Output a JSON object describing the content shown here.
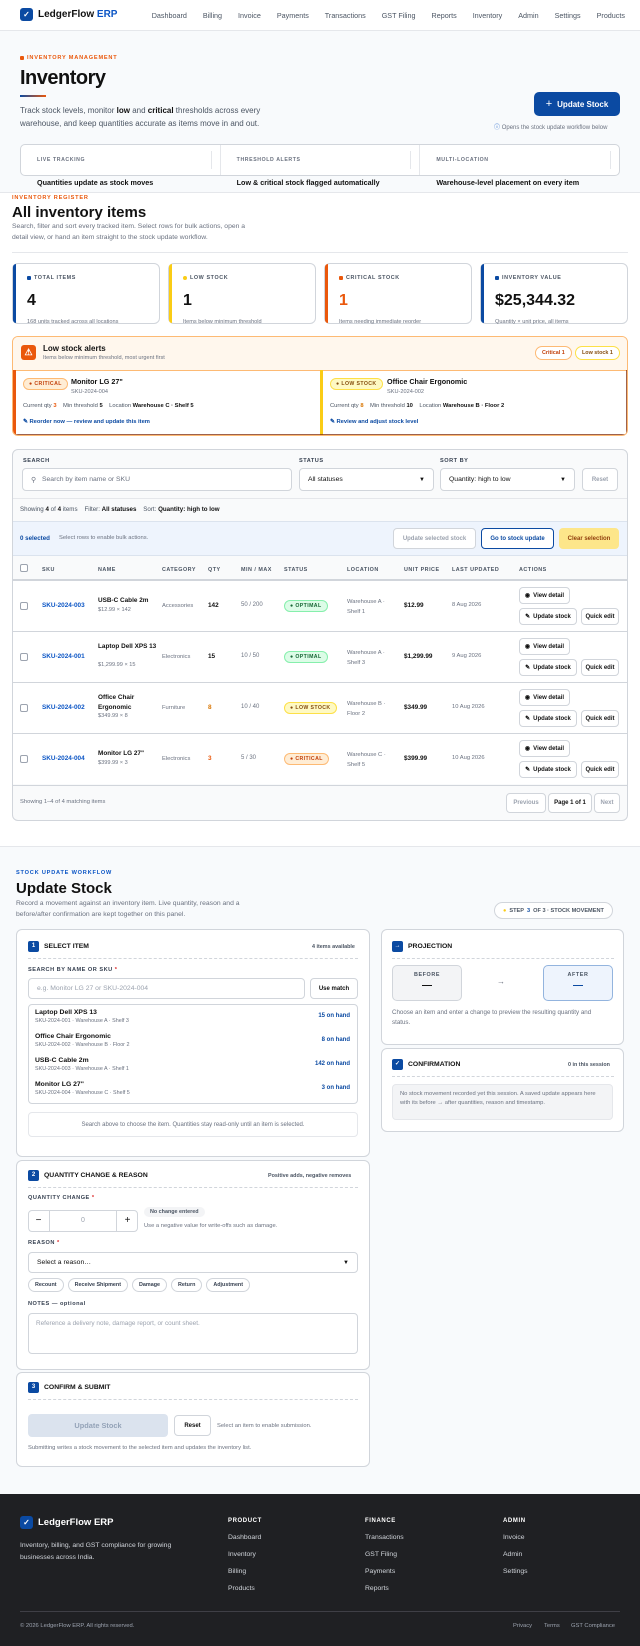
{
  "nav": {
    "brand_main": "LedgerFlow",
    "brand_accent": "ERP",
    "links": [
      "Dashboard",
      "Billing",
      "Invoice",
      "Payments",
      "Transactions",
      "GST Filing",
      "Reports",
      "Inventory",
      "Admin",
      "Settings",
      "Products"
    ]
  },
  "hero": {
    "eyebrow": "INVENTORY MANAGEMENT",
    "title": "Inventory",
    "desc_1": "Track stock levels, monitor ",
    "desc_low": "low",
    "desc_2": " and ",
    "desc_critical": "critical",
    "desc_3": " thresholds across every warehouse, and keep quantities accurate as items move in and out.",
    "cta": "Update Stock",
    "cta_hint": "Opens the stock update workflow below",
    "features": [
      {
        "k": "LIVE TRACKING",
        "v": "Quantities update as stock moves"
      },
      {
        "k": "THRESHOLD ALERTS",
        "v": "Low & critical stock flagged automatically"
      },
      {
        "k": "MULTI-LOCATION",
        "v": "Warehouse-level placement on every item"
      }
    ]
  },
  "register": {
    "eyebrow": "INVENTORY REGISTER",
    "title": "All inventory items",
    "desc": "Search, filter and sort every tracked item. Select rows for bulk actions, open a detail view, or hand an item straight to the stock update workflow."
  },
  "kpis": [
    {
      "label": "TOTAL ITEMS",
      "value": "4",
      "sub": "168 units tracked across all locations",
      "color": "#0b4aa2"
    },
    {
      "label": "LOW STOCK",
      "value": "1",
      "sub": "Items below minimum threshold",
      "color": "#facc15"
    },
    {
      "label": "CRITICAL STOCK",
      "value": "1",
      "sub": "Items needing immediate reorder",
      "color": "#ea580c"
    },
    {
      "label": "INVENTORY VALUE",
      "value": "$25,344.32",
      "sub": "Quantity × unit price, all items",
      "color": "#0b4aa2"
    }
  ],
  "alerts": {
    "title": "Low stock alerts",
    "sub": "Items below minimum threshold, most urgent first",
    "badge_critical": "Critical 1",
    "badge_low": "Low stock 1",
    "items": [
      {
        "status": "CRITICAL",
        "name": "Monitor LG 27\"",
        "sku": "SKU-2024-004",
        "qty_label": "Current qty",
        "qty": "3",
        "min_label": "Min threshold",
        "min": "5",
        "loc_label": "Location",
        "loc": "Warehouse C · Shelf 5",
        "action": "Reorder now — review and update this item"
      },
      {
        "status": "LOW STOCK",
        "name": "Office Chair Ergonomic",
        "sku": "SKU-2024-002",
        "qty_label": "Current qty",
        "qty": "8",
        "min_label": "Min threshold",
        "min": "10",
        "loc_label": "Location",
        "loc": "Warehouse B · Floor 2",
        "action": "Review and adjust stock level"
      }
    ]
  },
  "filters": {
    "search_label": "SEARCH",
    "search_placeholder": "Search by item name or SKU",
    "status_label": "STATUS",
    "status_value": "All statuses",
    "sort_label": "SORT BY",
    "sort_value": "Quantity: high to low",
    "reset": "Reset",
    "showing_prefix": "Showing",
    "shown": "4",
    "of": "of",
    "total": "4",
    "items_word": "items",
    "filter_label": "Filter:",
    "filter_value": "All statuses",
    "sort_label2": "Sort:",
    "sort_value2": "Quantity: high to low"
  },
  "bulk": {
    "selected": "0 selected",
    "hint": "Select rows to enable bulk actions.",
    "update_selected": "Update selected stock",
    "go_update": "Go to stock update",
    "clear": "Clear selection"
  },
  "table": {
    "headers": [
      "SKU",
      "NAME",
      "CATEGORY",
      "QTY",
      "MIN / MAX",
      "STATUS",
      "LOCATION",
      "UNIT PRICE",
      "LAST UPDATED",
      "ACTIONS"
    ],
    "rows": [
      {
        "sku": "SKU-2024-003",
        "name": "USB-C Cable 2m",
        "sub": "$12.99 × 142",
        "cat": "Accessories",
        "qty": "142",
        "minmax": "50 / 200",
        "status": "OPTIMAL",
        "loc": "Warehouse A · Shelf 1",
        "price": "$12.99",
        "updated": "8 Aug 2026",
        "qtycolor": "#111"
      },
      {
        "sku": "SKU-2024-001",
        "name": "Laptop Dell XPS 13",
        "sub": "$1,299.99 × 15",
        "cat": "Electronics",
        "qty": "15",
        "minmax": "10 / 50",
        "status": "OPTIMAL",
        "loc": "Warehouse A · Shelf 3",
        "price": "$1,299.99",
        "updated": "9 Aug 2026",
        "qtycolor": "#111"
      },
      {
        "sku": "SKU-2024-002",
        "name": "Office Chair Ergonomic",
        "sub": "$349.99 × 8",
        "cat": "Furniture",
        "qty": "8",
        "minmax": "10 / 40",
        "status": "LOW STOCK",
        "loc": "Warehouse B · Floor 2",
        "price": "$349.99",
        "updated": "10 Aug 2026",
        "qtycolor": "#d97706"
      },
      {
        "sku": "SKU-2024-004",
        "name": "Monitor LG 27\"",
        "sub": "$399.99 × 3",
        "cat": "Electronics",
        "qty": "3",
        "minmax": "5 / 30",
        "status": "CRITICAL",
        "loc": "Warehouse C · Shelf 5",
        "price": "$399.99",
        "updated": "10 Aug 2026",
        "qtycolor": "#ea580c"
      }
    ],
    "view": "View detail",
    "update": "Update stock",
    "quick": "Quick edit",
    "footer": "Showing 1–4 of 4 matching items",
    "prev": "Previous",
    "page": "Page 1 of 1",
    "next": "Next"
  },
  "workflow": {
    "eyebrow": "STOCK UPDATE WORKFLOW",
    "title": "Update Stock",
    "desc": "Record a movement against an inventory item. Live quantity, reason and a before/after confirmation are kept together on this panel.",
    "step_a": "STEP",
    "step_n": "3",
    "step_b": "OF 3 · STOCK MOVEMENT",
    "s1": {
      "num": "1",
      "title": "SELECT ITEM",
      "meta": "4 items available",
      "label": "SEARCH BY NAME OR SKU",
      "req": "*",
      "placeholder": "e.g. Monitor LG 27 or SKU-2024-004",
      "use": "Use match",
      "items": [
        {
          "name": "Laptop Dell XPS 13",
          "sub": "SKU-2024-001 · Warehouse A · Shelf 3",
          "hand": "15 on hand"
        },
        {
          "name": "Office Chair Ergonomic",
          "sub": "SKU-2024-002 · Warehouse B · Floor 2",
          "hand": "8 on hand"
        },
        {
          "name": "USB-C Cable 2m",
          "sub": "SKU-2024-003 · Warehouse A · Shelf 1",
          "hand": "142 on hand"
        },
        {
          "name": "Monitor LG 27\"",
          "sub": "SKU-2024-004 · Warehouse C · Shelf 5",
          "hand": "3 on hand"
        }
      ],
      "hint": "Search above to choose the item. Quantities stay read-only until an item is selected."
    },
    "s2": {
      "num": "2",
      "title": "QUANTITY CHANGE & REASON",
      "meta": "Positive adds, negative removes",
      "qlabel": "QUANTITY CHANGE",
      "qvalue": "0",
      "nochange": "No change entered",
      "neg_hint": "Use a negative value for write-offs such as damage.",
      "rlabel": "REASON",
      "rvalue": "Select a reason…",
      "reasons": [
        "Recount",
        "Receive Shipment",
        "Damage",
        "Return",
        "Adjustment"
      ],
      "nlabel": "NOTES — optional",
      "nplaceholder": "Reference a delivery note, damage report, or count sheet."
    },
    "s3": {
      "num": "3",
      "title": "CONFIRM & SUBMIT",
      "submit": "Update Stock",
      "reset": "Reset",
      "hint": "Select an item to enable submission.",
      "note": "Submitting writes a stock movement to the selected item and updates the inventory list."
    },
    "projection": {
      "title": "PROJECTION",
      "before": "BEFORE",
      "after": "AFTER",
      "dash": "—",
      "arrow": "→",
      "hint": "Choose an item and enter a change to preview the resulting quantity and status."
    },
    "confirmation": {
      "title": "CONFIRMATION",
      "meta": "0 in this session",
      "empty": "No stock movement recorded yet this session. A saved update appears here with its before → after quantities, reason and timestamp."
    }
  },
  "footer": {
    "brand": "LedgerFlow ERP",
    "desc": "Inventory, billing, and GST compliance for growing businesses across India.",
    "cols": [
      {
        "h": "PRODUCT",
        "links": [
          "Dashboard",
          "Inventory",
          "Billing",
          "Products"
        ]
      },
      {
        "h": "FINANCE",
        "links": [
          "Transactions",
          "GST Filing",
          "Payments",
          "Reports"
        ]
      },
      {
        "h": "ADMIN",
        "links": [
          "Invoice",
          "Admin",
          "Settings"
        ]
      }
    ],
    "copy": "© 2026 LedgerFlow ERP. All rights reserved.",
    "legal": [
      "Privacy",
      "Terms",
      "GST Compliance"
    ]
  }
}
